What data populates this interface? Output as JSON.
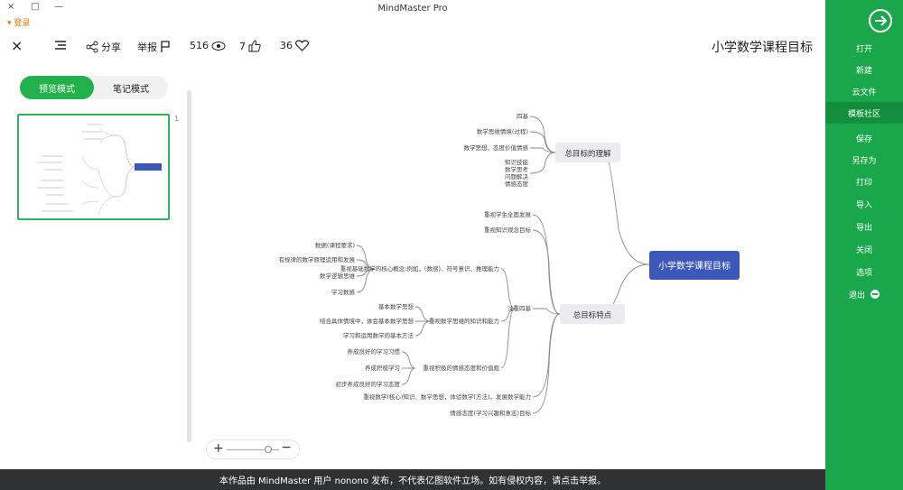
{
  "window": {
    "title": "MindMaster Pro",
    "brand": "登录",
    "controls": [
      "×",
      "□",
      "—"
    ]
  },
  "toolbar": {
    "close": "×",
    "share": "分享",
    "report": "举报",
    "views": "516",
    "likes": "7",
    "favorites": "36",
    "doc_title": "小学数学课程目标"
  },
  "left_panel": {
    "modes": [
      "预览模式",
      "笔记模式"
    ],
    "active_mode": 0,
    "page_no": "1"
  },
  "mindmap": {
    "root": "小学数学课程目标",
    "branch1": {
      "title": "总目标的理解",
      "leaves": [
        "四基",
        "数学思维情境(过程)",
        "数学思想、态度价值情感",
        "知识技能\n数学思考\n问题解决\n情感态度"
      ]
    },
    "branch2": {
      "title": "总目标特点",
      "children": [
        {
          "text": "重视学生全面发展"
        },
        {
          "text": "重视知识观念目标"
        },
        {
          "text": "注重四基",
          "children": [
            {
              "text": "重视基础数学的核心概念:例如，(数感)、符号意识、推理能力",
              "children": [
                "数据(课程要求)",
                "有规律的数学原理运用和发展",
                "数学逻辑思维",
                "学习数感"
              ]
            },
            {
              "text": "重视数学思维的知识和能力",
              "children": [
                "基本数学思想",
                "结合具体情境中，体会基本数学思想",
                "学习和运用数学的基本方法"
              ]
            },
            {
              "text": "重视积极的情感态度和价值观",
              "children": [
                "养成良好的学习习惯",
                "养成积极学习",
                "初步养成良好的学习态度"
              ]
            }
          ]
        },
        {
          "text": "重视数学(核心)知识、数学思想，体验数学(方法)，发展数学能力"
        },
        {
          "text": "情感态度(学习兴趣和意志)目标"
        }
      ]
    }
  },
  "zoom": {
    "plus": "+",
    "minus": "−"
  },
  "footer": "本作品由 MindMaster 用户 nonono 发布，不代表亿图软件立场。如有侵权内容，请点击举报。",
  "sidebar": {
    "items": [
      "打开",
      "新建",
      "云文件",
      "模板社区",
      "保存",
      "另存为",
      "打印",
      "导入",
      "导出",
      "关闭",
      "选项",
      "退出"
    ],
    "active_index": 3
  },
  "colors": {
    "sidebar": "#1aa74b",
    "sidebar_active": "#128e3c",
    "root_node": "#3b57b8",
    "branch_node": "#ececf0",
    "connector": "#8a8a8a",
    "footer": "#2f3133"
  }
}
